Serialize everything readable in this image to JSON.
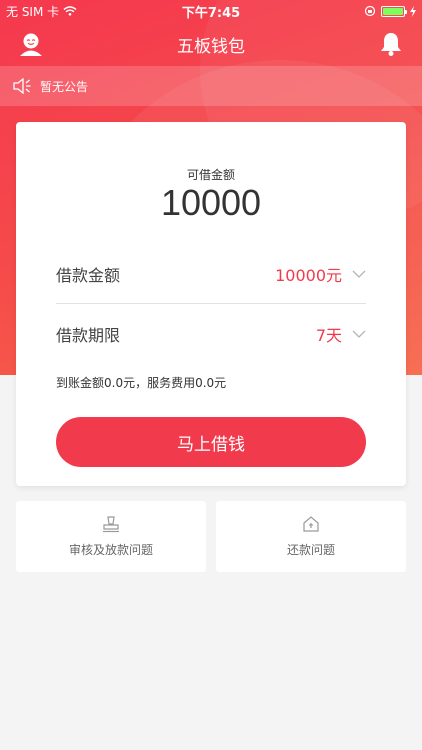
{
  "status_bar": {
    "carrier": "无 SIM 卡",
    "time": "下午7:45",
    "battery_level": 1.0
  },
  "nav": {
    "title": "五板钱包",
    "left_icon": "user-icon",
    "right_icon": "bell-icon"
  },
  "notice": {
    "icon": "speaker-icon",
    "text": "暂无公告"
  },
  "loan_card": {
    "available_label": "可借金额",
    "available_amount": "10000",
    "amount_label": "借款金额",
    "amount_value": "10000元",
    "term_label": "借款期限",
    "term_value": "7天",
    "summary": "到账金额0.0元，服务费用0.0元",
    "borrow_button": "马上借钱"
  },
  "help": {
    "review_label": "审核及放款问题",
    "review_icon": "stamp-icon",
    "repay_label": "还款问题",
    "repay_icon": "house-icon"
  },
  "colors": {
    "accent": "#f23a4d",
    "hero_start": "#f5384f",
    "hero_end": "#f7664a"
  }
}
